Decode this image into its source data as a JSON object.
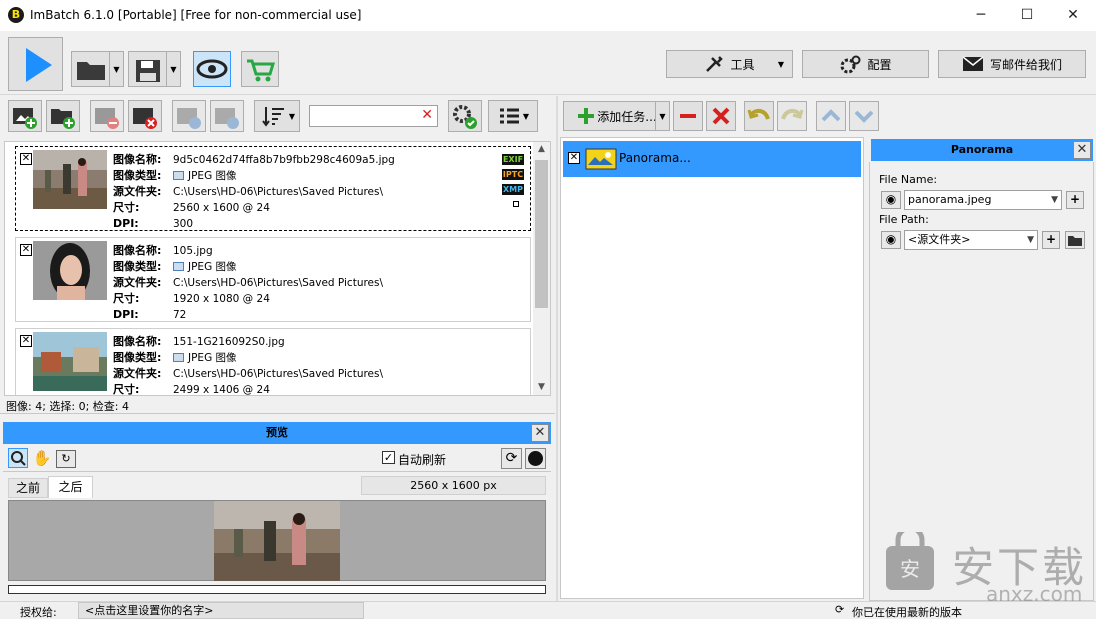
{
  "window": {
    "title": "ImBatch 6.1.0 [Portable] [Free for non-commercial use]",
    "minimize": "─",
    "maximize": "☐",
    "close": "✕"
  },
  "toolbar": {
    "tools_label": "工具",
    "config_label": "配置",
    "email_label": "写邮件给我们"
  },
  "images": {
    "search_value": "",
    "items": [
      {
        "name_label": "图像名称:",
        "name": "9d5c0462d74ffa8b7b9fbb298c4609a5.jpg",
        "type_label": "图像类型:",
        "type": "JPEG 图像",
        "folder_label": "源文件夹:",
        "folder": "C:\\Users\\HD-06\\Pictures\\Saved Pictures\\",
        "size_label": "尺寸:",
        "size": "2560 x 1600 @ 24",
        "dpi_label": "DPI:",
        "dpi": "300",
        "checked": "✕"
      },
      {
        "name_label": "图像名称:",
        "name": "105.jpg",
        "type_label": "图像类型:",
        "type": "JPEG 图像",
        "folder_label": "源文件夹:",
        "folder": "C:\\Users\\HD-06\\Pictures\\Saved Pictures\\",
        "size_label": "尺寸:",
        "size": "1920 x 1080 @ 24",
        "dpi_label": "DPI:",
        "dpi": "72",
        "checked": "✕"
      },
      {
        "name_label": "图像名称:",
        "name": "151-1G216092S0.jpg",
        "type_label": "图像类型:",
        "type": "JPEG 图像",
        "folder_label": "源文件夹:",
        "folder": "C:\\Users\\HD-06\\Pictures\\Saved Pictures\\",
        "size_label": "尺寸:",
        "size": "2499 x 1406 @ 24",
        "checked": "✕"
      }
    ],
    "tags": [
      "EXIF",
      "IPTC",
      "XMP"
    ],
    "status": "图像: 4; 选择: 0; 检查: 4"
  },
  "preview": {
    "title": "预览",
    "auto_refresh": "自动刷新",
    "tab_before": "之前",
    "tab_after": "之后",
    "dimensions": "2560 x 1600 px"
  },
  "tasks": {
    "add_label": "添加任务...",
    "items": [
      {
        "label": "Panorama...",
        "checked": "✕"
      }
    ]
  },
  "panorama": {
    "title": "Panorama",
    "file_name_label": "File Name:",
    "file_name_value": "panorama.jpeg",
    "file_path_label": "File Path:",
    "file_path_value": "<源文件夹>"
  },
  "statusbar": {
    "license_label": "授权给:",
    "license_value": "<点击这里设置你的名字>",
    "version_status": "你已在使用最新的版本"
  },
  "watermark": {
    "text": "安下载",
    "domain": "anxz.com"
  },
  "colors": {
    "accent": "#3399ff",
    "play": "#1e90ff",
    "green": "#2ca02c",
    "red": "#d62020"
  }
}
